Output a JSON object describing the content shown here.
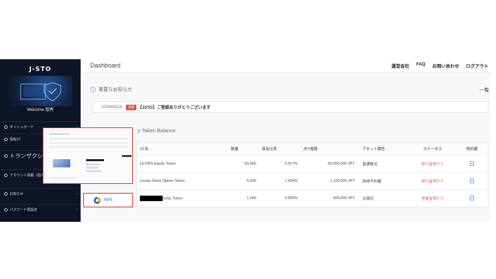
{
  "sidebar": {
    "brand": "J-STO",
    "welcome": "Welcome 智秀",
    "items": [
      {
        "label": "ダッシュボード"
      },
      {
        "label": "保有ST"
      },
      {
        "label": "トランザクション履"
      },
      {
        "label": "アカウント情報（個人）"
      },
      {
        "label": "お知らせ"
      },
      {
        "label": "パスワード再設定"
      }
    ]
  },
  "header": {
    "title": "Dashboard",
    "links": [
      "運営会社",
      "FAQ",
      "お問い合わせ",
      "ログアウト"
    ]
  },
  "notices": {
    "heading": "重要なお知らせ",
    "more": "一覧",
    "items": [
      {
        "date": "2019/09/18",
        "badge": "重要",
        "text": "【JSTO】ご登録ありがとうございます"
      }
    ]
  },
  "balance": {
    "heading": "y Token Balance",
    "columns": [
      "ST名",
      "数量",
      "保有比率",
      "JPY換算",
      "アセット属性",
      "ステータス",
      "契約書"
    ],
    "rows": [
      {
        "name": "LEVIAS Equity Token",
        "qty": "50,000",
        "ratio": "0.917%",
        "jpy": "50,000,000 JPY",
        "asset": "普通株式",
        "status": "発行者預かり"
      },
      {
        "name": "Levias Stock Option Token",
        "qty": "5,000",
        "ratio": "1.424%",
        "jpy": "1,100,000 JPY",
        "asset": "新株予約権",
        "status": "発行者預かり"
      },
      {
        "name": "Solar Token",
        "qty": "1,000",
        "ratio": "5.000%",
        "jpy": "500,000 JPY",
        "asset": "太陽光",
        "status": "営業者預かり"
      }
    ]
  },
  "overlay": {
    "rps_label": "RPS"
  },
  "colors": {
    "sidebar_bg": "#0d1526",
    "badge": "#e74c3c",
    "status": "#e8675a",
    "highlight_border": "#d33030",
    "link_blue": "#2b6cb0"
  }
}
